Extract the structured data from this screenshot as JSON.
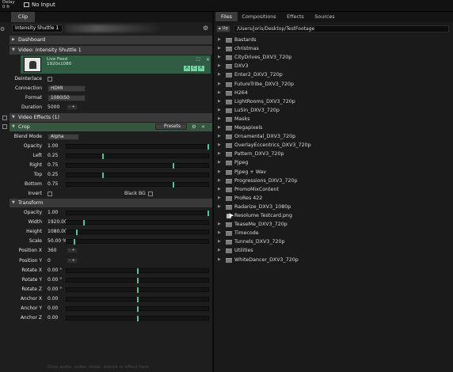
{
  "topbar": {
    "delay_label": "Delay",
    "delay_value": "0 fr",
    "input_label": "No Input"
  },
  "left": {
    "tab": "Clip",
    "clip_name": "Intensity Shuttle 1",
    "sections": {
      "dashboard": "Dashboard",
      "video": "Video: Intensity Shuttle 1",
      "effects": "Video Effects (1)",
      "crop": "Crop",
      "transform": "Transform"
    },
    "preview": {
      "title": "Live Feed",
      "size": "1920x1080",
      "buttons": [
        "A",
        "C",
        "R"
      ]
    },
    "video_props": [
      {
        "label": "Deinterlace",
        "value": ""
      },
      {
        "label": "Connection",
        "value": "HDMI"
      },
      {
        "label": "Format",
        "value": "1080i50"
      },
      {
        "label": "Duration",
        "value": "5000"
      }
    ],
    "crop": {
      "presets_label": "Presets",
      "blend_label": "Blend Mode",
      "blend_value": "Alpha",
      "params": [
        {
          "label": "Opacity",
          "value": "1.00",
          "level": 1.0
        },
        {
          "label": "Left",
          "value": "0.25",
          "level": 0.25
        },
        {
          "label": "Right",
          "value": "0.75",
          "level": 0.75
        },
        {
          "label": "Top",
          "value": "0.25",
          "level": 0.25
        },
        {
          "label": "Bottom",
          "value": "0.75",
          "level": 0.75
        }
      ],
      "invert_label": "Invert",
      "blackbg_label": "Black BG"
    },
    "transform": {
      "params": [
        {
          "label": "Opacity",
          "value": "1.00",
          "level": 1.0,
          "kind": "slider"
        },
        {
          "label": "Width",
          "value": "1920.00",
          "level": 0.12,
          "kind": "slider"
        },
        {
          "label": "Height",
          "value": "1080.00",
          "level": 0.07,
          "kind": "slider"
        },
        {
          "label": "Scale",
          "value": "50.00 %",
          "level": 0.05,
          "kind": "slider"
        },
        {
          "label": "Position X",
          "value": "360",
          "kind": "pm"
        },
        {
          "label": "Position Y",
          "value": "0",
          "kind": "pm"
        },
        {
          "label": "Rotate X",
          "value": "0.00 °",
          "level": 0.5,
          "kind": "slider"
        },
        {
          "label": "Rotate Y",
          "value": "0.00 °",
          "level": 0.5,
          "kind": "slider"
        },
        {
          "label": "Rotate Z",
          "value": "0.00 °",
          "level": 0.5,
          "kind": "slider"
        },
        {
          "label": "Anchor X",
          "value": "0.00",
          "level": 0.5,
          "kind": "slider"
        },
        {
          "label": "Anchor Y",
          "value": "0.00",
          "level": 0.5,
          "kind": "slider"
        },
        {
          "label": "Anchor Z",
          "value": "0.00",
          "level": 0.5,
          "kind": "slider"
        }
      ]
    },
    "hint": "Drop audio, video, mask, source or effect here"
  },
  "right": {
    "tabs": [
      "Files",
      "Compositions",
      "Effects",
      "Sources"
    ],
    "up_label": "Up",
    "path": "/Users/joris/Desktop/TestFootage",
    "files": [
      {
        "name": "Bastards",
        "type": "folder"
      },
      {
        "name": "christmas",
        "type": "folder"
      },
      {
        "name": "CityDrives_DXV3_720p",
        "type": "folder"
      },
      {
        "name": "DXV3",
        "type": "folder"
      },
      {
        "name": "Enter2_DXV3_720p",
        "type": "folder"
      },
      {
        "name": "FutureTribe_DXV3_720p",
        "type": "folder"
      },
      {
        "name": "H264",
        "type": "folder"
      },
      {
        "name": "LightRooms_DXV3_720p",
        "type": "folder"
      },
      {
        "name": "LuSin_DXV3_720p",
        "type": "folder"
      },
      {
        "name": "Masks",
        "type": "folder"
      },
      {
        "name": "Megapixels",
        "type": "folder"
      },
      {
        "name": "Ornamental_DXV3_720p",
        "type": "folder"
      },
      {
        "name": "OverlayEccentrics_DXV3_720p",
        "type": "folder"
      },
      {
        "name": "Pattern_DXV3_720p",
        "type": "folder"
      },
      {
        "name": "Pjpeg",
        "type": "folder"
      },
      {
        "name": "Pjpeg + Wav",
        "type": "folder"
      },
      {
        "name": "Progressions_DXV3_720p",
        "type": "folder"
      },
      {
        "name": "PromoMixContent",
        "type": "folder"
      },
      {
        "name": "ProRes 422",
        "type": "folder"
      },
      {
        "name": "Radarize_DXV3_1080p",
        "type": "folder"
      },
      {
        "name": "Resolume Testcard.png",
        "type": "file"
      },
      {
        "name": "TeaseMe_DXV3_720p",
        "type": "folder"
      },
      {
        "name": "Timecode",
        "type": "folder"
      },
      {
        "name": "Tunnels_DXV3_720p",
        "type": "folder"
      },
      {
        "name": "Utilities",
        "type": "folder"
      },
      {
        "name": "WhiteDancer_DXV3_720p",
        "type": "folder"
      }
    ]
  }
}
